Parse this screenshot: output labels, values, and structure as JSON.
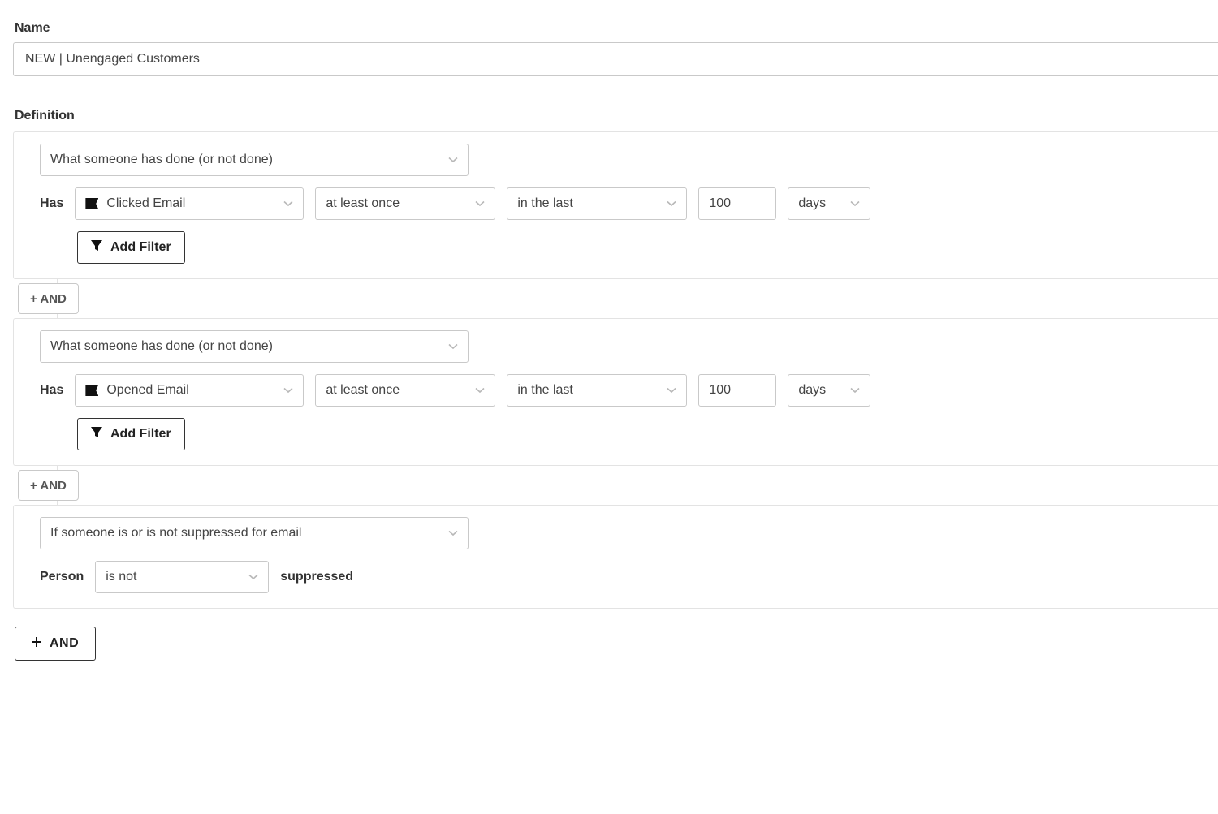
{
  "name_field": {
    "label": "Name",
    "value": "NEW | Unengaged Customers"
  },
  "definition_label": "Definition",
  "common": {
    "and_connector": "+ AND",
    "add_filter": "Add Filter",
    "has_label": "Has",
    "person_label": "Person",
    "suppressed_label": "suppressed"
  },
  "rules": [
    {
      "condition_type": "What someone has done (or not done)",
      "metric": "Clicked Email",
      "count_operator": "at least once",
      "time_range": "in the last",
      "time_value": "100",
      "time_unit": "days"
    },
    {
      "condition_type": "What someone has done (or not done)",
      "metric": "Opened Email",
      "count_operator": "at least once",
      "time_range": "in the last",
      "time_value": "100",
      "time_unit": "days"
    },
    {
      "condition_type": "If someone is or is not suppressed for email",
      "is_operator": "is not"
    }
  ],
  "final_and_label": "AND"
}
